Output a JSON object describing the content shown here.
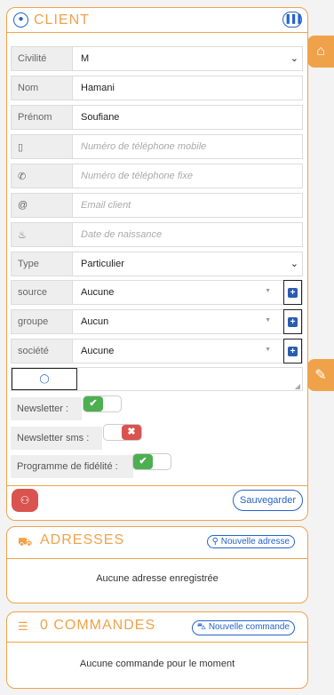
{
  "client": {
    "title": "CLIENT",
    "fields": {
      "civilite_label": "Civilité",
      "civilite_value": "M",
      "nom_label": "Nom",
      "nom_value": "Hamani",
      "prenom_label": "Prénom",
      "prenom_value": "Soufiane",
      "mobile_icon": "▯",
      "mobile_placeholder": "Numéro de téléphone mobile",
      "fixe_icon": "✆",
      "fixe_placeholder": "Numéro de téléphone fixe",
      "email_icon": "@",
      "email_placeholder": "Email client",
      "birth_icon": "♨",
      "birth_placeholder": "Date de naissance",
      "type_label": "Type",
      "type_value": "Particulier",
      "source_label": "source",
      "source_value": "Aucune",
      "groupe_label": "groupe",
      "groupe_value": "Aucun",
      "societe_label": "société",
      "societe_value": "Aucune"
    },
    "toggles": {
      "newsletter_label": "Newsletter :",
      "newsletter_on": true,
      "newsletter_sms_label": "Newsletter sms :",
      "newsletter_sms_on": false,
      "fidelite_label": "Programme de fidélité :",
      "fidelite_on": true
    },
    "save_label": "Sauvegarder"
  },
  "adresses": {
    "title": "ADRESSES",
    "new_label": "Nouvelle adresse",
    "empty": "Aucune adresse enregistrée"
  },
  "commandes": {
    "title": "0 COMMANDES",
    "new_label": "Nouvelle commande",
    "empty": "Aucune commande pour le moment"
  },
  "colors": {
    "accent": "#f0a24a",
    "blue": "#2563c9",
    "green": "#4caf50",
    "red": "#d9534f"
  }
}
